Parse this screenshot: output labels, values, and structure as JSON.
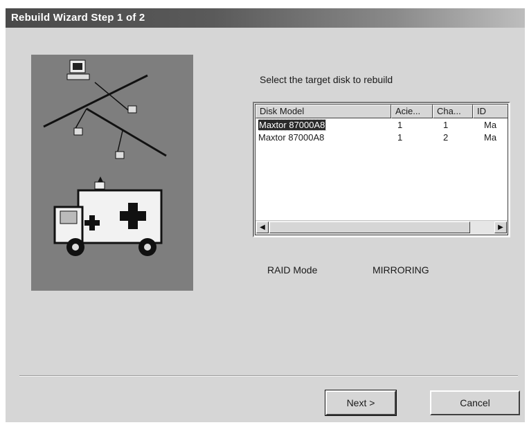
{
  "window": {
    "title": "Rebuild Wizard Step 1 of 2"
  },
  "main": {
    "prompt": "Select the target disk to rebuild",
    "list": {
      "columns": [
        "Disk Model",
        "Acie...",
        "Cha...",
        "ID"
      ],
      "rows": [
        {
          "model": "Maxtor 87000A8",
          "acie": "1",
          "cha": "1",
          "id": "Ma",
          "selected": true
        },
        {
          "model": "Maxtor 87000A8",
          "acie": "1",
          "cha": "2",
          "id": "Ma",
          "selected": false
        }
      ]
    },
    "raid_mode_label": "RAID Mode",
    "raid_mode_value": "MIRRORING"
  },
  "buttons": {
    "next_label": "Next >",
    "cancel_label": "Cancel"
  },
  "icons": {
    "scroll_left": "scroll-left-arrow-icon",
    "scroll_right": "scroll-right-arrow-icon"
  },
  "colors": {
    "title_bar": "#4a4a4a",
    "dialog_bg": "#d6d6d6",
    "art_panel": "#7e7e7e",
    "selection": "#2a2a2a"
  }
}
